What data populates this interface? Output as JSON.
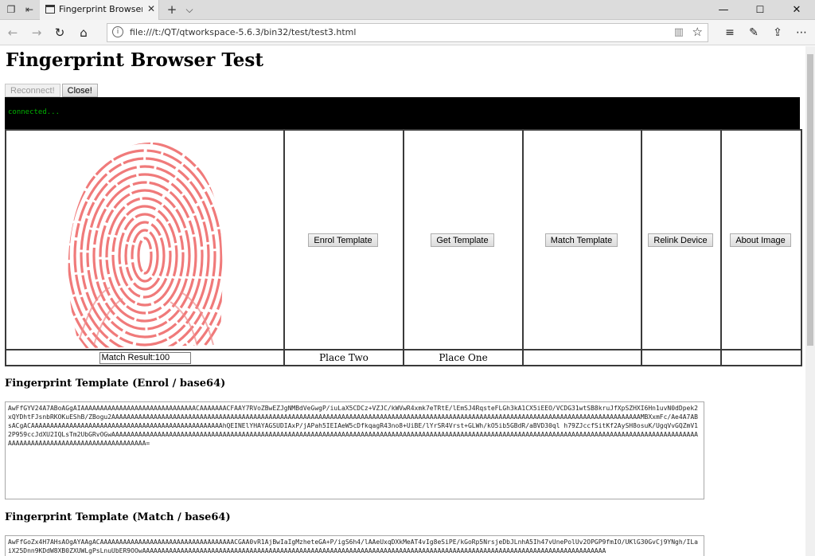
{
  "browser": {
    "tab_title": "Fingerprint Browser Test",
    "url": "file:///t:/QT/qtworkspace-5.6.3/bin32/test/test3.html",
    "icons": {
      "tab_sets": "tab-sets-icon",
      "set_aside": "set-aside-icon",
      "back": "back-arrow-icon",
      "forward": "forward-arrow-icon",
      "refresh": "refresh-icon",
      "home": "home-icon",
      "info": "info-icon",
      "reading_view": "reading-view-icon",
      "favorite": "star-icon",
      "favorites_hub": "favorites-hub-icon",
      "notes": "pen-icon",
      "share": "share-icon",
      "more": "more-icon"
    }
  },
  "page": {
    "title": "Fingerprint Browser Test",
    "buttons": {
      "reconnect": "Reconnect!",
      "close": "Close!"
    },
    "console_text": "connected...",
    "grid": {
      "actions": [
        "Enrol Template",
        "Get Template",
        "Match Template",
        "Relink Device",
        "About Image"
      ],
      "match_result": "Match Result:100",
      "place_two": "Place Two",
      "place_one": "Place One"
    },
    "enrol_heading": "Fingerprint Template (Enrol / base64)",
    "enrol_template": "AwFfGYV24A7ABoAGgAIAAAAAAAAAAAAAAAAAAAAAAAAAAAAAACAAAAAAACFAAY7RVoZBwEZJgNMBdVeGwgP/iuLaX5CDCz+VZJC/kWVwR4xmk7eTRtE/lEmSJ4RqsteFLGh3kA1CX5iEEO/VCDG31wtSB8kruJfXpSZHXI6Hn1uvN0dDpek2xQYDhtFJsnbRKOKuEShB/ZBogu2AAAAAAAAAAAAAAAAAAAAAAAAAAAAAAAAAAAAAAAAAAAAAAAAAAAAAAAAAAAAAAAAAAAAAAAAAAAAAAAAAAAAAAAAAAAAAAAAAAAAAAAAAAAAAAAAAAAAAAAAAAAAAAAAAAAAAAAAAAMBXxmFc/Ae4A7ABsACgACAAAAAAAAAAAAAAAAAAAAAAAAAAAAAAAAAAAAAAAAAAAAAAAAAAhQEINElYHAYAGSUDIAxP/jAPah5IEIAeW5cDfkqagR43no8+UiBE/lYrSR4Vrst+GLWh/kO5ib5GBdR/aBVD30ql h79ZJccfSitKf2AySH8osuK/UgqVvGQZmV12P959ccJdXU2IQLsTm2UbGRvOGwAAAAAAAAAAAAAAAAAAAAAAAAAAAAAAAAAAAAAAAAAAAAAAAAAAAAAAAAAAAAAAAAAAAAAAAAAAAAAAAAAAAAAAAAAAAAAAAAAAAAAAAAAAAAAAAAAAAAAAAAAAAAAAAAAAAAAAAAAAAAAAAAAAAAAAAAAAAAAAAAAAAAAAAAAAAAAAAAAAAAAAAAAAAAA=",
    "match_heading": "Fingerprint Template (Match / base64)",
    "match_template": "AwFfGoZx4H7AHsAOgAYAAgACAAAAAAAAAAAAAAAAAAAAAAAAAAAAAAAAAAACGAA0vR1AjBwIaIgMzheteGA+P/igS6h4/lAAeUxqDXkMeAT4vIg8eSiPE/kGoRp5NrsjeDbJLnhA5Ih47vUnePolUv2OPGP9fmIO/UKlG30GvCj9YNgh/ILaiX25Dnn9KDdW8XB0ZXUWLgPsLnuUbER9OOwAAAAAAAAAAAAAAAAAAAAAAAAAAAAAAAAAAAAAAAAAAAAAAAAAAAAAAAAAAAAAAAAAAAAAAAAAAAAAAAAAAAAAAAAAAAAAAAAAAAAAAAAAAAAAAAAAAAAAAAAA"
  }
}
